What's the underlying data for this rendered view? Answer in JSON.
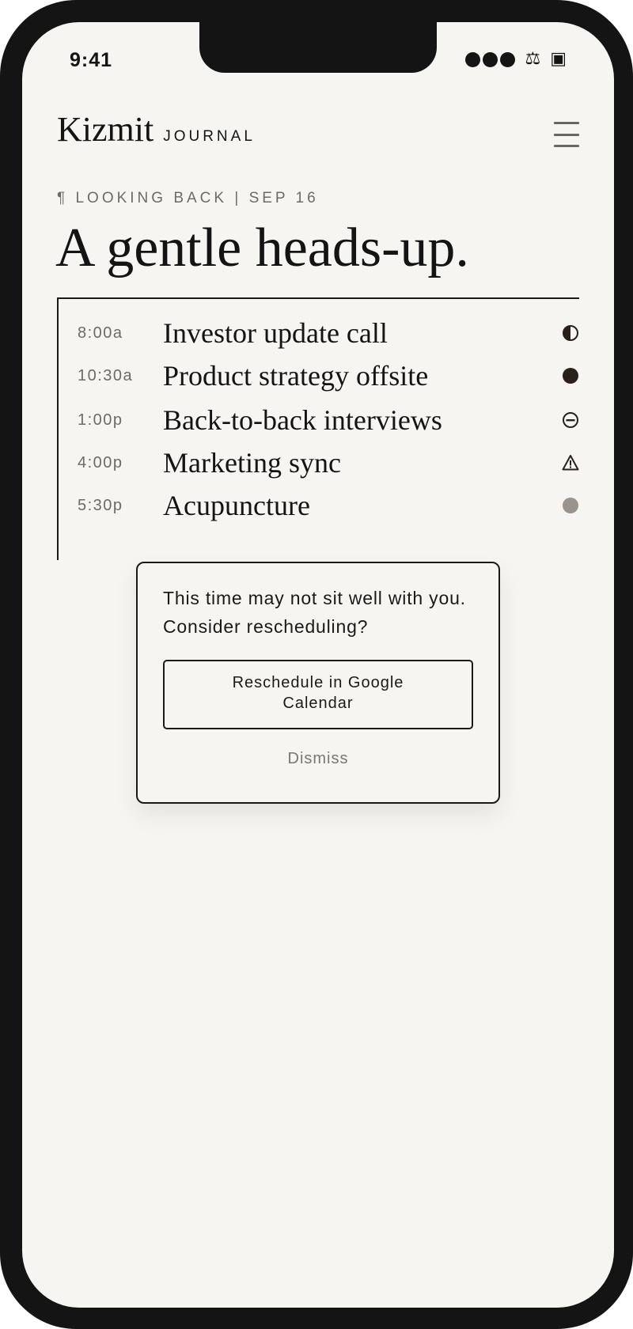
{
  "status_bar": {
    "time": "9:41",
    "icons": [
      "cellular-signal-icon",
      "wifi-icon",
      "battery-icon"
    ],
    "wifi_glyph": "⚖",
    "battery_glyph": "▣"
  },
  "header": {
    "brand": "Kizmit",
    "subtitle": "JOURNAL",
    "menu_icon": "hamburger-menu-icon"
  },
  "section": {
    "eyebrow": "¶  LOOKING BACK | SEP 16",
    "title": "A gentle heads-up."
  },
  "events": [
    {
      "time": "8:00a",
      "title": "Investor update call",
      "icon": "half-circle-icon"
    },
    {
      "time": "10:30a",
      "title": "Product strategy offsite",
      "icon": "filled-circle-icon"
    },
    {
      "time": "1:00p",
      "title": "Back-to-back interviews",
      "icon": "minus-circle-icon"
    },
    {
      "time": "4:00p",
      "title": "Marketing sync",
      "icon": "warning-triangle-icon"
    },
    {
      "time": "5:30p",
      "title": "Acupuncture",
      "icon": "gray-circle-icon"
    }
  ],
  "dialog": {
    "message": "This time may not sit well with you. Consider rescheduling?",
    "primary_button": "Reschedule in Google Calendar",
    "secondary_button": "Dismiss"
  },
  "colors": {
    "background": "#f6f5f1",
    "ink": "#141414",
    "muted": "#6e6a64",
    "icon_dark": "#2b211c",
    "icon_gray": "#9a948c",
    "device_frame": "#141414"
  }
}
